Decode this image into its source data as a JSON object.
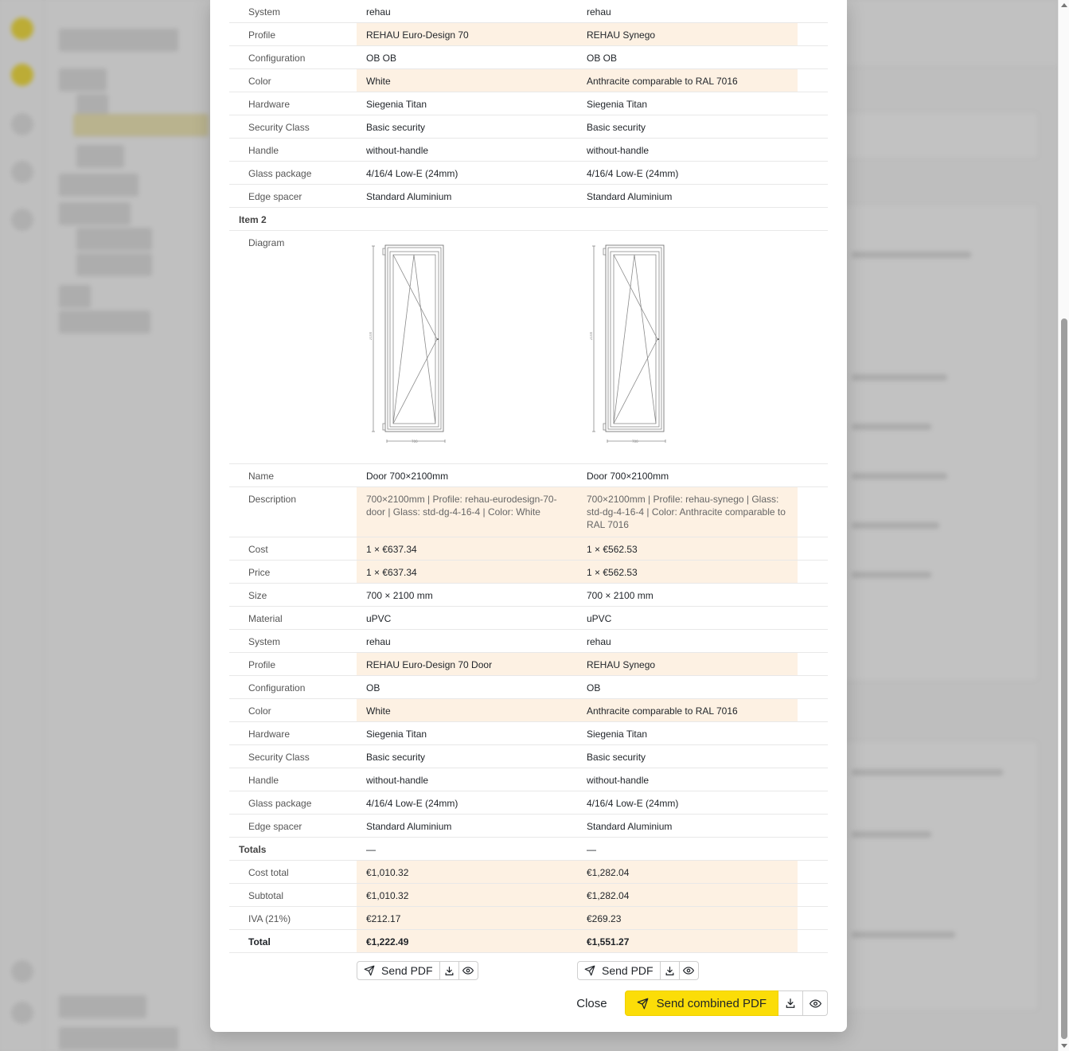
{
  "items": [
    {
      "label": "",
      "rows": [
        {
          "label": "System",
          "a": "rehau",
          "b": "rehau",
          "diff": false
        },
        {
          "label": "Profile",
          "a": "REHAU Euro-Design 70",
          "b": "REHAU Synego",
          "diff": true
        },
        {
          "label": "Configuration",
          "a": "OB OB",
          "b": "OB OB",
          "diff": false
        },
        {
          "label": "Color",
          "a": "White",
          "b": "Anthracite comparable to RAL 7016",
          "diff": true
        },
        {
          "label": "Hardware",
          "a": "Siegenia Titan",
          "b": "Siegenia Titan",
          "diff": false
        },
        {
          "label": "Security Class",
          "a": "Basic security",
          "b": "Basic security",
          "diff": false
        },
        {
          "label": "Handle",
          "a": "without-handle",
          "b": "without-handle",
          "diff": false
        },
        {
          "label": "Glass package",
          "a": "4/16/4 Low-E (24mm)",
          "b": "4/16/4 Low-E (24mm)",
          "diff": false
        },
        {
          "label": "Edge spacer",
          "a": "Standard Aluminium",
          "b": "Standard Aluminium",
          "diff": false
        }
      ]
    },
    {
      "label": "Item 2",
      "diagram_label": "Diagram",
      "diagram_dims": {
        "height": "2100",
        "width": "700"
      },
      "rows": [
        {
          "label": "Name",
          "a": "Door 700×2100mm",
          "b": "Door 700×2100mm",
          "diff": false
        },
        {
          "label": "Description",
          "a": "700×2100mm | Profile: rehau-eurodesign-70-door | Glass: std-dg-4-16-4 | Color: White",
          "b": "700×2100mm | Profile: rehau-synego | Glass: std-dg-4-16-4 | Color: Anthracite comparable to RAL 7016",
          "diff": true,
          "desc": true
        },
        {
          "label": "Cost",
          "a": "1 × €637.34",
          "b": "1 × €562.53",
          "diff": true
        },
        {
          "label": "Price",
          "a": "1 × €637.34",
          "b": "1 × €562.53",
          "diff": true
        },
        {
          "label": "Size",
          "a": "700 × 2100 mm",
          "b": "700 × 2100 mm",
          "diff": false
        },
        {
          "label": "Material",
          "a": "uPVC",
          "b": "uPVC",
          "diff": false
        },
        {
          "label": "System",
          "a": "rehau",
          "b": "rehau",
          "diff": false
        },
        {
          "label": "Profile",
          "a": "REHAU Euro-Design 70 Door",
          "b": "REHAU Synego",
          "diff": true
        },
        {
          "label": "Configuration",
          "a": "OB",
          "b": "OB",
          "diff": false
        },
        {
          "label": "Color",
          "a": "White",
          "b": "Anthracite comparable to RAL 7016",
          "diff": true
        },
        {
          "label": "Hardware",
          "a": "Siegenia Titan",
          "b": "Siegenia Titan",
          "diff": false
        },
        {
          "label": "Security Class",
          "a": "Basic security",
          "b": "Basic security",
          "diff": false
        },
        {
          "label": "Handle",
          "a": "without-handle",
          "b": "without-handle",
          "diff": false
        },
        {
          "label": "Glass package",
          "a": "4/16/4 Low-E (24mm)",
          "b": "4/16/4 Low-E (24mm)",
          "diff": false
        },
        {
          "label": "Edge spacer",
          "a": "Standard Aluminium",
          "b": "Standard Aluminium",
          "diff": false
        }
      ]
    }
  ],
  "totals": {
    "label": "Totals",
    "a": "—",
    "b": "—",
    "rows": [
      {
        "label": "Cost total",
        "a": "€1,010.32",
        "b": "€1,282.04",
        "diff": true
      },
      {
        "label": "Subtotal",
        "a": "€1,010.32",
        "b": "€1,282.04",
        "diff": true
      },
      {
        "label": "IVA (21%)",
        "a": "€212.17",
        "b": "€269.23",
        "diff": true
      },
      {
        "label": "Total",
        "a": "€1,222.49",
        "b": "€1,551.27",
        "diff": true,
        "bold": true
      }
    ]
  },
  "actions": {
    "send_pdf": "Send PDF",
    "close": "Close",
    "send_combined_pdf": "Send combined PDF"
  },
  "icons": {
    "send": "send-icon",
    "download": "download-icon",
    "preview": "eye-icon"
  },
  "colors": {
    "primary": "#fbdd08",
    "diff_highlight": "#fdf1e3",
    "overlay": "rgba(120,120,120,0.45)"
  }
}
